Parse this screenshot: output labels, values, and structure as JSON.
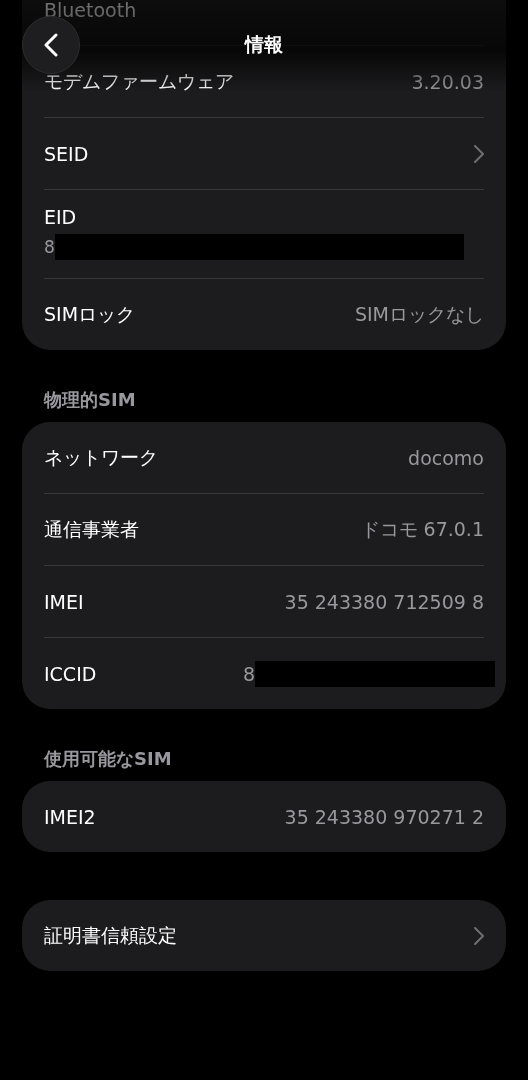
{
  "header": {
    "title": "情報"
  },
  "groups": [
    {
      "rows": [
        {
          "kind": "value",
          "label": "Bluetooth"
        },
        {
          "kind": "value",
          "label": "モデムファームウェア",
          "value": "3.20.03"
        },
        {
          "kind": "chevron",
          "label": "SEID"
        },
        {
          "kind": "stacked",
          "label": "EID",
          "value": "8"
        },
        {
          "kind": "value",
          "label": "SIMロック",
          "value": "SIMロックなし"
        }
      ]
    },
    {
      "title": "物理的SIM",
      "rows": [
        {
          "kind": "value",
          "label": "ネットワーク",
          "value": "docomo"
        },
        {
          "kind": "value",
          "label": "通信事業者",
          "value": "ドコモ 67.0.1"
        },
        {
          "kind": "value",
          "label": "IMEI",
          "value": "35 243380 712509 8"
        },
        {
          "kind": "redacted",
          "label": "ICCID",
          "value": "8"
        }
      ]
    },
    {
      "title": "使用可能なSIM",
      "rows": [
        {
          "kind": "value",
          "label": "IMEI2",
          "value": "35 243380 970271 2"
        }
      ]
    },
    {
      "rows": [
        {
          "kind": "chevron",
          "label": "証明書信頼設定"
        }
      ]
    }
  ]
}
